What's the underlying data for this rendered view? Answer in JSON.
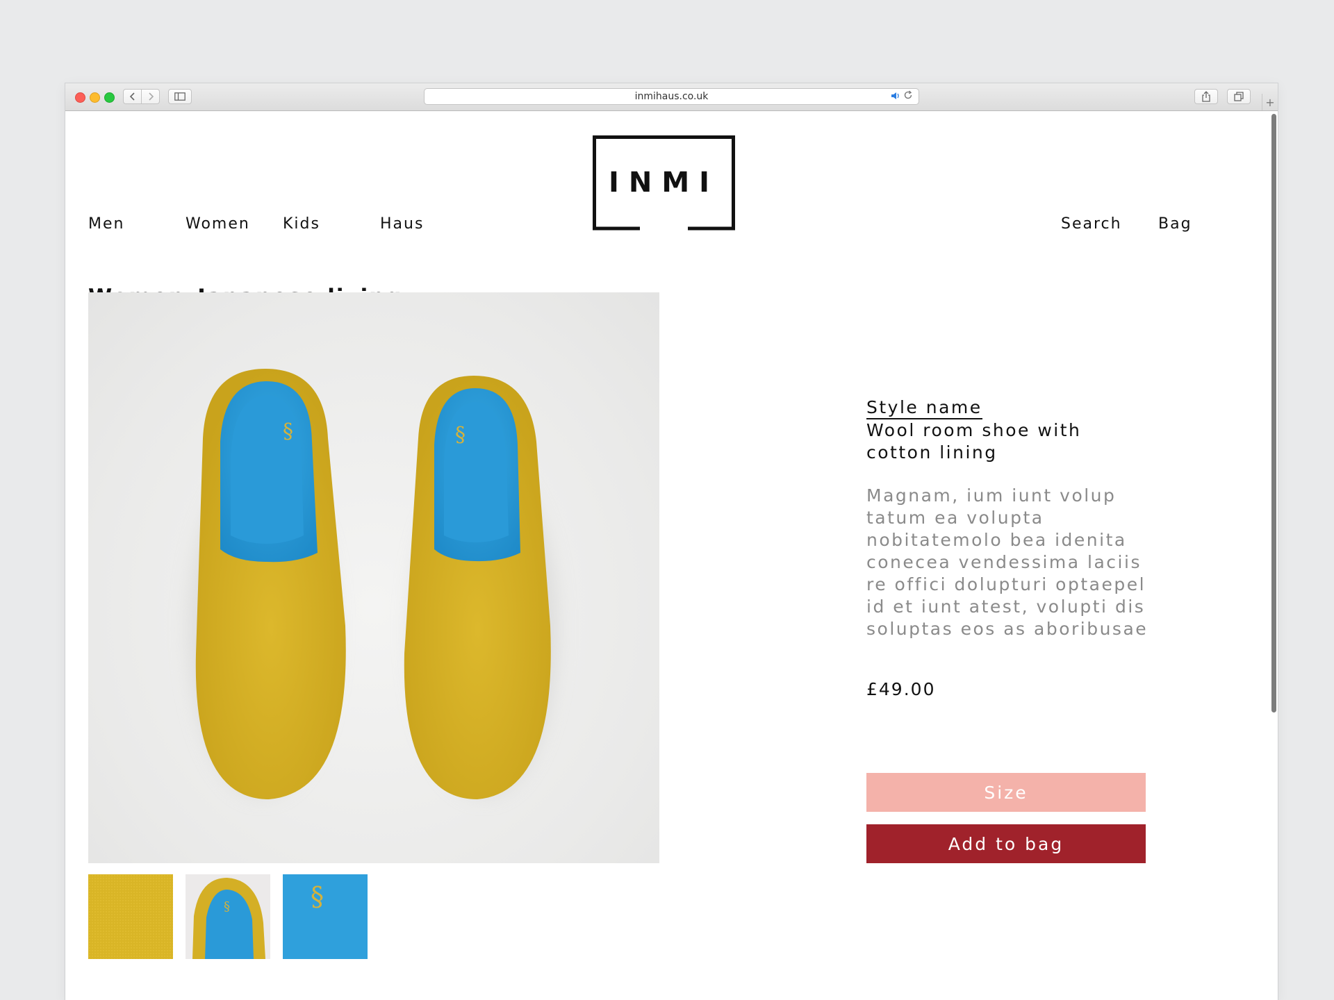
{
  "browser": {
    "url": "inmihaus.co.uk",
    "plus": "+"
  },
  "nav": {
    "left": [
      {
        "label": "Men"
      },
      {
        "label": "Women"
      },
      {
        "label": "Kids"
      },
      {
        "label": "Haus"
      }
    ],
    "right": [
      {
        "label": "Search"
      },
      {
        "label": "Bag"
      }
    ]
  },
  "brand": {
    "logo_text": "INMI"
  },
  "page": {
    "title": "Women_Japanese living"
  },
  "product": {
    "style_label": "Style name",
    "style_value": "Wool room shoe with cotton lining",
    "description": "Magnam, ium iunt volup tatum ea volupta nobitatemolo bea idenita conecea vendessima laciis re offici dolupturi optaepel id et iunt atest, volupti dis soluptas eos as aboribusae",
    "price": "£49.00",
    "size_label": "Size",
    "add_label": "Add to bag"
  },
  "colors": {
    "size_button": "#f4b2aa",
    "add_button": "#a0222b",
    "slipper_yellow": "#d8b326",
    "slipper_lining": "#2c9fdb"
  },
  "icons": {
    "back": "chevron-left-icon",
    "forward": "chevron-right-icon",
    "sidebar": "sidebar-icon",
    "share": "share-icon",
    "tabs": "tabs-icon",
    "sound": "speaker-icon",
    "reload": "reload-icon"
  }
}
